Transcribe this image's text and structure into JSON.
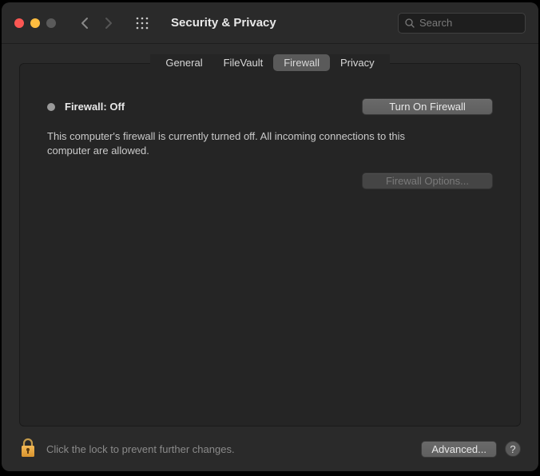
{
  "header": {
    "title": "Security & Privacy",
    "search_placeholder": "Search"
  },
  "tabs": [
    {
      "label": "General"
    },
    {
      "label": "FileVault"
    },
    {
      "label": "Firewall"
    },
    {
      "label": "Privacy"
    }
  ],
  "firewall": {
    "status_label": "Firewall: Off",
    "turn_on_label": "Turn On Firewall",
    "description": "This computer's firewall is currently turned off. All incoming connections to this computer are allowed.",
    "options_label": "Firewall Options..."
  },
  "footer": {
    "lock_text": "Click the lock to prevent further changes.",
    "advanced_label": "Advanced...",
    "help_label": "?"
  }
}
